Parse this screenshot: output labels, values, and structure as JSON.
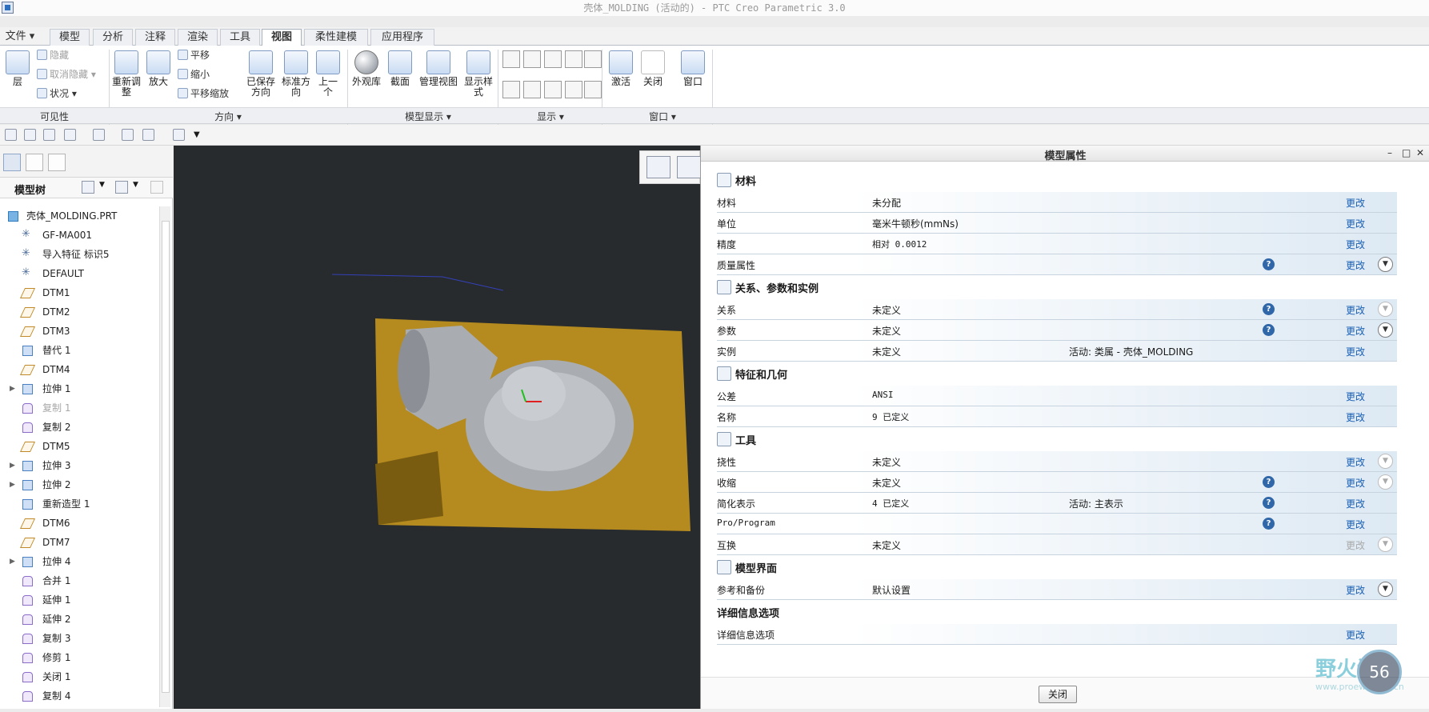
{
  "window": {
    "title": "壳体_MOLDING (活动的) - PTC Creo Parametric 3.0"
  },
  "tabs": [
    {
      "label": "文件",
      "active": false
    },
    {
      "label": "模型",
      "active": false
    },
    {
      "label": "分析",
      "active": false
    },
    {
      "label": "注释",
      "active": false
    },
    {
      "label": "渲染",
      "active": false
    },
    {
      "label": "工具",
      "active": false
    },
    {
      "label": "视图",
      "active": true
    },
    {
      "label": "柔性建模",
      "active": false
    },
    {
      "label": "应用程序",
      "active": false
    }
  ],
  "ribbon": {
    "visibility": {
      "layer": "层",
      "hide": "隐藏",
      "unhide": "取消隐藏",
      "status": "状况",
      "group": "可见性"
    },
    "orientation": {
      "refit": "重新调整",
      "zoom_in": "放大",
      "pan": "平移",
      "zoom_out": "缩小",
      "pan_zoom": "平移缩放",
      "saved": "已保存方向",
      "standard": "标准方向",
      "previous": "上一个",
      "group": "方向"
    },
    "model_display": {
      "appearance": "外观库",
      "section": "截面",
      "manage": "管理视图",
      "style": "显示样式",
      "group": "模型显示"
    },
    "display": {
      "group": "显示"
    },
    "window": {
      "activate": "激活",
      "close": "关闭",
      "window": "窗口",
      "group": "窗口"
    }
  },
  "model_tree": {
    "header": "模型树",
    "items": [
      {
        "label": "壳体_MOLDING.PRT",
        "icon": "part-icon",
        "root": true
      },
      {
        "label": "GF-MA001",
        "icon": "csys-icon"
      },
      {
        "label": "导入特征 标识5",
        "icon": "csys-icon"
      },
      {
        "label": "DEFAULT",
        "icon": "csys-icon"
      },
      {
        "label": "DTM1",
        "icon": "datum-plane-icon"
      },
      {
        "label": "DTM2",
        "icon": "datum-plane-icon"
      },
      {
        "label": "DTM3",
        "icon": "datum-plane-icon"
      },
      {
        "label": "替代 1",
        "icon": "feature-icon"
      },
      {
        "label": "DTM4",
        "icon": "datum-plane-icon"
      },
      {
        "label": "拉伸 1",
        "icon": "feature-icon",
        "expandable": true
      },
      {
        "label": "复制 1",
        "icon": "copy-icon",
        "dim": true
      },
      {
        "label": "复制 2",
        "icon": "copy-icon"
      },
      {
        "label": "DTM5",
        "icon": "datum-plane-icon"
      },
      {
        "label": "拉伸 3",
        "icon": "feature-icon",
        "expandable": true
      },
      {
        "label": "拉伸 2",
        "icon": "feature-icon",
        "expandable": true
      },
      {
        "label": "重新造型 1",
        "icon": "feature-icon"
      },
      {
        "label": "DTM6",
        "icon": "datum-plane-icon"
      },
      {
        "label": "DTM7",
        "icon": "datum-plane-icon"
      },
      {
        "label": "拉伸 4",
        "icon": "feature-icon",
        "expandable": true
      },
      {
        "label": "合并 1",
        "icon": "copy-icon"
      },
      {
        "label": "延伸 1",
        "icon": "copy-icon"
      },
      {
        "label": "延伸 2",
        "icon": "copy-icon"
      },
      {
        "label": "复制 3",
        "icon": "copy-icon"
      },
      {
        "label": "修剪 1",
        "icon": "copy-icon"
      },
      {
        "label": "关闭 1",
        "icon": "copy-icon"
      },
      {
        "label": "复制 4",
        "icon": "copy-icon"
      }
    ]
  },
  "dialog": {
    "title": "模型属性",
    "sections": [
      {
        "title": "材料",
        "rows": [
          {
            "key": "材料",
            "value": "未分配",
            "edit": "更改"
          },
          {
            "key": "单位",
            "value": "毫米牛顿秒(mmNs)",
            "edit": "更改"
          },
          {
            "key": "精度",
            "value": "相对 0.0012",
            "edit": "更改"
          },
          {
            "key": "质量属性",
            "value": "",
            "edit": "更改",
            "help": true,
            "chev": true
          }
        ]
      },
      {
        "title": "关系、参数和实例",
        "rows": [
          {
            "key": "关系",
            "value": "未定义",
            "edit": "更改",
            "help": true,
            "chev": true,
            "chev_dim": true
          },
          {
            "key": "参数",
            "value": "未定义",
            "edit": "更改",
            "help": true,
            "chev": true
          },
          {
            "key": "实例",
            "value": "未定义",
            "extra": "活动: 类属 - 壳体_MOLDING",
            "edit": "更改"
          }
        ]
      },
      {
        "title": "特征和几何",
        "rows": [
          {
            "key": "公差",
            "value": "ANSI",
            "edit": "更改"
          },
          {
            "key": "名称",
            "value": "9 已定义",
            "edit": "更改"
          }
        ]
      },
      {
        "title": "工具",
        "rows": [
          {
            "key": "挠性",
            "value": "未定义",
            "edit": "更改",
            "chev": true,
            "chev_dim": true
          },
          {
            "key": "收缩",
            "value": "未定义",
            "edit": "更改",
            "help": true,
            "chev": true,
            "chev_dim": true
          },
          {
            "key": "简化表示",
            "value": "4 已定义",
            "extra": "活动: 主表示",
            "edit": "更改",
            "help": true
          },
          {
            "key": "Pro/Program",
            "value": "",
            "edit": "更改",
            "help": true
          },
          {
            "key": "互换",
            "value": "未定义",
            "edit": "更改",
            "edit_dim": true,
            "chev": true,
            "chev_dim": true
          }
        ]
      },
      {
        "title": "模型界面",
        "rows": [
          {
            "key": "参考和备份",
            "value": "默认设置",
            "edit": "更改",
            "chev": true
          }
        ]
      },
      {
        "title": "详细信息选项",
        "noicon": true,
        "rows": [
          {
            "key": "详细信息选项",
            "value": "",
            "edit": "更改"
          }
        ]
      }
    ],
    "close_button": "关闭"
  },
  "watermark": {
    "text": "野火论坛",
    "url": "www.proewildfire.cn",
    "badge": "56"
  },
  "colors": {
    "viewport_bg": "#272b2d",
    "mold_plate": "#b58a1e",
    "part": "#a9adb2",
    "link": "#1a5fb4"
  }
}
